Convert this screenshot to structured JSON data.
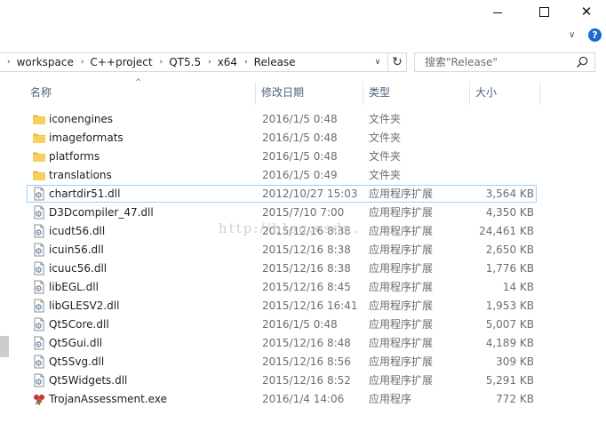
{
  "window": {
    "minimize_icon": "minimize-icon",
    "maximize_icon": "maximize-icon",
    "close_icon": "close-icon",
    "close_glyph": "✕"
  },
  "ribbon": {
    "expand_glyph": "∨",
    "help_glyph": "?"
  },
  "address": {
    "separator_glyph": "›",
    "crumbs": [
      "workspace",
      "C++project",
      "QT5.5",
      "x64",
      "Release"
    ],
    "dropdown_glyph": "∨",
    "refresh_glyph": "↻"
  },
  "search": {
    "placeholder": "搜索\"Release\""
  },
  "columns": {
    "name": "名称",
    "date": "修改日期",
    "type": "类型",
    "size": "大小",
    "sort_glyph": "^"
  },
  "files": [
    {
      "name": "iconengines",
      "date": "2016/1/5 0:48",
      "type": "文件夹",
      "size": "",
      "icon": "folder-icon"
    },
    {
      "name": "imageformats",
      "date": "2016/1/5 0:48",
      "type": "文件夹",
      "size": "",
      "icon": "folder-icon"
    },
    {
      "name": "platforms",
      "date": "2016/1/5 0:48",
      "type": "文件夹",
      "size": "",
      "icon": "folder-icon"
    },
    {
      "name": "translations",
      "date": "2016/1/5 0:49",
      "type": "文件夹",
      "size": "",
      "icon": "folder-icon"
    },
    {
      "name": "chartdir51.dll",
      "date": "2012/10/27 15:03",
      "type": "应用程序扩展",
      "size": "3,564 KB",
      "icon": "dll-file-icon",
      "selected": true
    },
    {
      "name": "D3Dcompiler_47.dll",
      "date": "2015/7/10 7:00",
      "type": "应用程序扩展",
      "size": "4,350 KB",
      "icon": "dll-file-icon"
    },
    {
      "name": "icudt56.dll",
      "date": "2015/12/16 8:38",
      "type": "应用程序扩展",
      "size": "24,461 KB",
      "icon": "dll-file-icon"
    },
    {
      "name": "icuin56.dll",
      "date": "2015/12/16 8:38",
      "type": "应用程序扩展",
      "size": "2,650 KB",
      "icon": "dll-file-icon"
    },
    {
      "name": "icuuc56.dll",
      "date": "2015/12/16 8:38",
      "type": "应用程序扩展",
      "size": "1,776 KB",
      "icon": "dll-file-icon"
    },
    {
      "name": "libEGL.dll",
      "date": "2015/12/16 8:45",
      "type": "应用程序扩展",
      "size": "14 KB",
      "icon": "dll-file-icon"
    },
    {
      "name": "libGLESV2.dll",
      "date": "2015/12/16 16:41",
      "type": "应用程序扩展",
      "size": "1,953 KB",
      "icon": "dll-file-icon"
    },
    {
      "name": "Qt5Core.dll",
      "date": "2016/1/5 0:48",
      "type": "应用程序扩展",
      "size": "5,007 KB",
      "icon": "dll-file-icon"
    },
    {
      "name": "Qt5Gui.dll",
      "date": "2015/12/16 8:48",
      "type": "应用程序扩展",
      "size": "4,189 KB",
      "icon": "dll-file-icon"
    },
    {
      "name": "Qt5Svg.dll",
      "date": "2015/12/16 8:56",
      "type": "应用程序扩展",
      "size": "309 KB",
      "icon": "dll-file-icon"
    },
    {
      "name": "Qt5Widgets.dll",
      "date": "2015/12/16 8:52",
      "type": "应用程序扩展",
      "size": "5,291 KB",
      "icon": "dll-file-icon"
    },
    {
      "name": "TrojanAssessment.exe",
      "date": "2016/1/4 14:06",
      "type": "应用程序",
      "size": "772 KB",
      "icon": "app-exe-icon"
    }
  ],
  "watermark": "http://blog.csdn.",
  "colors": {
    "header_text": "#4c607a",
    "selection_border": "#99d1ff",
    "folder": "#f0c24a",
    "secondary_text": "#6d6d6d"
  }
}
